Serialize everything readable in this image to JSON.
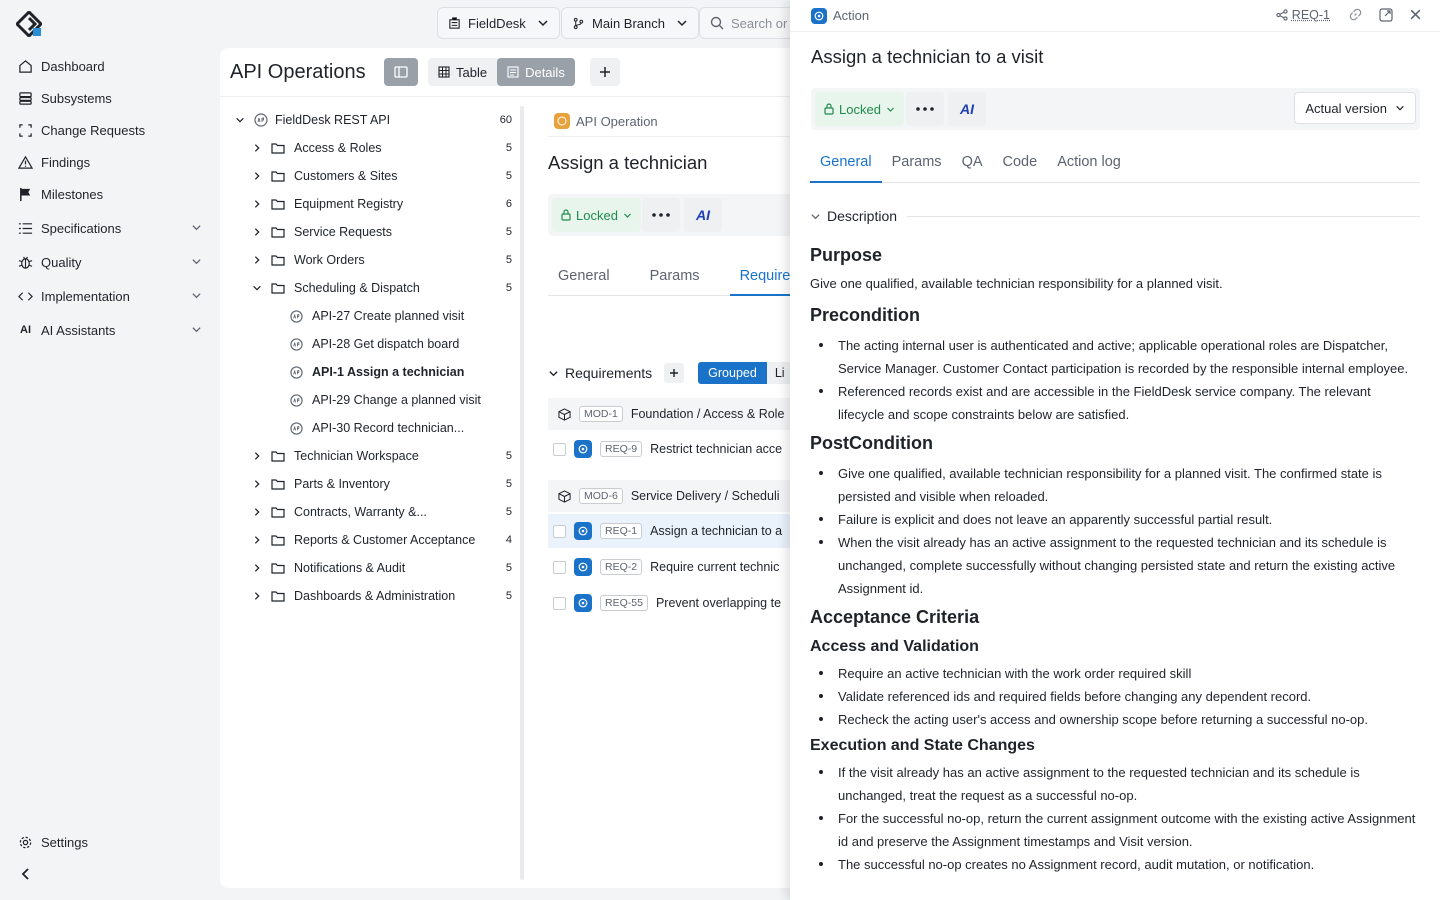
{
  "sidebar": {
    "items": [
      {
        "label": "Dashboard",
        "icon": "home-icon",
        "expandable": false
      },
      {
        "label": "Subsystems",
        "icon": "database-icon",
        "expandable": false
      },
      {
        "label": "Change Requests",
        "icon": "change-request-icon",
        "expandable": false
      },
      {
        "label": "Findings",
        "icon": "warning-icon",
        "expandable": false
      },
      {
        "label": "Milestones",
        "icon": "flag-icon",
        "expandable": false
      },
      {
        "label": "Specifications",
        "icon": "list-icon",
        "expandable": true
      },
      {
        "label": "Quality",
        "icon": "bug-icon",
        "expandable": true
      },
      {
        "label": "Implementation",
        "icon": "code-icon",
        "expandable": true
      },
      {
        "label": "AI Assistants",
        "icon": "ai-icon",
        "expandable": true
      }
    ],
    "settings_label": "Settings"
  },
  "topbar": {
    "project": "FieldDesk",
    "branch": "Main Branch",
    "search_placeholder": "Search or"
  },
  "main": {
    "title": "API Operations",
    "view_table": "Table",
    "view_details": "Details",
    "tree": {
      "root": {
        "label": "FieldDesk REST API",
        "count": "60"
      },
      "folders_before": [
        {
          "label": "Access & Roles",
          "count": "5"
        },
        {
          "label": "Customers & Sites",
          "count": "5"
        },
        {
          "label": "Equipment Registry",
          "count": "6"
        },
        {
          "label": "Service Requests",
          "count": "5"
        },
        {
          "label": "Work Orders",
          "count": "5"
        }
      ],
      "open_folder": {
        "label": "Scheduling & Dispatch",
        "count": "5"
      },
      "operations": [
        {
          "label": "API-27 Create planned visit",
          "active": false
        },
        {
          "label": "API-28 Get dispatch board",
          "active": false
        },
        {
          "label": "API-1 Assign a technician",
          "active": true
        },
        {
          "label": "API-29 Change a planned visit",
          "active": false
        },
        {
          "label": "API-30 Record technician...",
          "active": false
        }
      ],
      "folders_after": [
        {
          "label": "Technician Workspace",
          "count": "5"
        },
        {
          "label": "Parts & Inventory",
          "count": "5"
        },
        {
          "label": "Contracts, Warranty &...",
          "count": "5"
        },
        {
          "label": "Reports & Customer Acceptance",
          "count": "4"
        },
        {
          "label": "Notifications & Audit",
          "count": "5"
        },
        {
          "label": "Dashboards & Administration",
          "count": "5"
        }
      ]
    },
    "detail": {
      "kind": "API Operation",
      "title": "Assign a technician",
      "lock_label": "Locked",
      "ai_label": "AI",
      "tabs": [
        "General",
        "Params",
        "Requirement"
      ],
      "requirements_label": "Requirements",
      "grouped_label": "Grouped",
      "list_label": "Li",
      "groups": [
        {
          "tag": "MOD-1",
          "label": "Foundation / Access & Role",
          "reqs": [
            {
              "tag": "REQ-9",
              "label": "Restrict technician acce",
              "selected": false
            }
          ]
        },
        {
          "tag": "MOD-6",
          "label": "Service Delivery / Scheduli",
          "reqs": [
            {
              "tag": "REQ-1",
              "label": "Assign a technician to a",
              "selected": true
            },
            {
              "tag": "REQ-2",
              "label": "Require current technic",
              "selected": false
            },
            {
              "tag": "REQ-55",
              "label": "Prevent overlapping te",
              "selected": false
            }
          ]
        }
      ]
    }
  },
  "panel": {
    "kind": "Action",
    "req_id": "REQ-1",
    "title": "Assign a technician to a visit",
    "lock_label": "Locked",
    "ai_label": "AI",
    "version_label": "Actual version",
    "tabs": [
      "General",
      "Params",
      "QA",
      "Code",
      "Action log"
    ],
    "description_label": "Description",
    "sections": {
      "purpose_h": "Purpose",
      "purpose_p": "Give one qualified, available technician responsibility for a planned visit.",
      "pre_h": "Precondition",
      "pre": [
        "The acting internal user is authenticated and active; applicable operational roles are Dispatcher, Service Manager. Customer Contact participation is recorded by the responsible internal employee.",
        "Referenced records exist and are accessible in the FieldDesk service company. The relevant lifecycle and scope constraints below are satisfied."
      ],
      "post_h": "PostCondition",
      "post": [
        "Give one qualified, available technician responsibility for a planned visit. The confirmed state is persisted and visible when reloaded.",
        "Failure is explicit and does not leave an apparently successful partial result.",
        "When the visit already has an active assignment to the requested technician and its schedule is unchanged, complete successfully without changing persisted state and return the existing active Assignment id."
      ],
      "ac_h": "Acceptance Criteria",
      "av_h": "Access and Validation",
      "av": [
        "Require an active technician with the work order required skill",
        "Validate referenced ids and required fields before changing any dependent record.",
        "Recheck the acting user's access and ownership scope before returning a successful no-op."
      ],
      "es_h": "Execution and State Changes",
      "es": [
        "If the visit already has an active assignment to the requested technician and its schedule is unchanged, treat the request as a successful no-op.",
        "For the successful no-op, return the current assignment outcome with the existing active Assignment id and preserve the Assignment timestamps and Visit version.",
        "The successful no-op creates no Assignment record, audit mutation, or notification."
      ]
    }
  }
}
